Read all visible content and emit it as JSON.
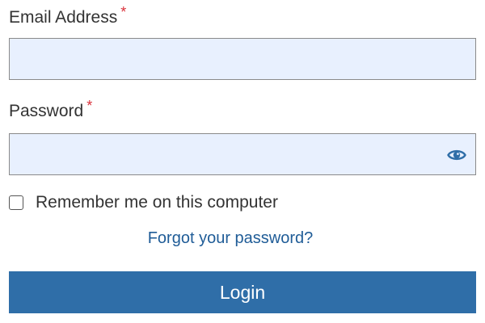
{
  "form": {
    "email": {
      "label": "Email Address",
      "required_marker": "*",
      "value": ""
    },
    "password": {
      "label": "Password",
      "required_marker": "*",
      "value": "",
      "toggle_icon": "eye-icon"
    },
    "remember": {
      "label": "Remember me on this computer",
      "checked": false
    },
    "forgot_link": "Forgot your password?",
    "login_label": "Login"
  },
  "colors": {
    "field_background": "#e8f0fe",
    "required_marker": "#d9303a",
    "link": "#1f5c97",
    "button": "#2f6ea8",
    "eye_icon": "#2f6ea8"
  }
}
